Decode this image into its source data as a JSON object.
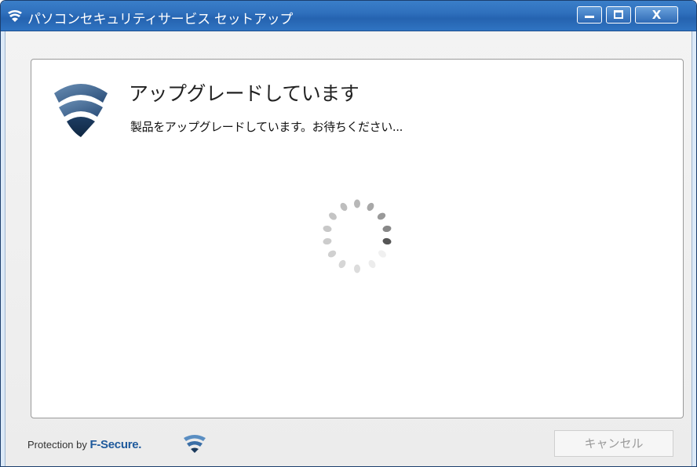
{
  "window": {
    "title": "パソコンセキュリティサービス セットアップ",
    "controls": {
      "close_label": "X"
    }
  },
  "content": {
    "heading": "アップグレードしています",
    "message": "製品をアップグレードしています。お待ちください..."
  },
  "footer": {
    "brand_prefix": "Protection by ",
    "brand_name": "F-Secure.",
    "cancel_label": "キャンセル"
  },
  "colors": {
    "title_bar": "#2f70bd",
    "brand_blue": "#1f5a9c",
    "logo_dark": "#1b3a5c",
    "spinner_active": "#555555"
  },
  "icons": [
    "shield-logo-icon",
    "loading-spinner-icon",
    "minimize-icon",
    "maximize-icon",
    "close-icon"
  ]
}
